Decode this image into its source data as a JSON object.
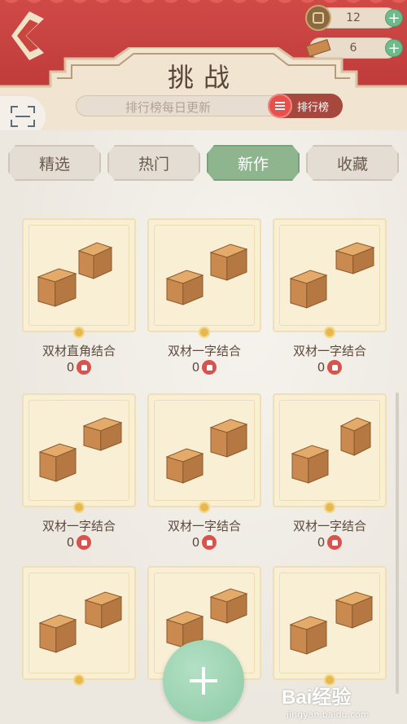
{
  "header": {
    "title": "挑战",
    "rank_hint": "排行榜每日更新",
    "rank_button": "排行榜",
    "coins": "12",
    "bricks": "6"
  },
  "tabs": [
    {
      "label": "精选"
    },
    {
      "label": "热门"
    },
    {
      "label": "新作",
      "active": true
    },
    {
      "label": "收藏"
    }
  ],
  "puzzles": [
    {
      "name": "双材直角结合",
      "likes": "0"
    },
    {
      "name": "双材一字结合",
      "likes": "0"
    },
    {
      "name": "双材一字结合",
      "likes": "0"
    },
    {
      "name": "双材一字结合",
      "likes": "0"
    },
    {
      "name": "双材一字结合",
      "likes": "0"
    },
    {
      "name": "双材一字结合",
      "likes": "0"
    },
    {
      "name": "",
      "likes": ""
    },
    {
      "name": "",
      "likes": ""
    },
    {
      "name": "",
      "likes": ""
    }
  ],
  "watermark": {
    "brand": "Bai",
    "brand2": "经验",
    "url": "jingyan.baidu.com"
  },
  "colors": {
    "header_red": "#c9463f",
    "active_tab": "#8fb58f",
    "wood": "#c9894f",
    "like_red": "#d9524c"
  },
  "icons": {
    "back": "back-arrow-icon",
    "scan": "scan-icon",
    "list": "list-icon",
    "add": "plus-icon",
    "like": "thumbs-up-icon"
  }
}
